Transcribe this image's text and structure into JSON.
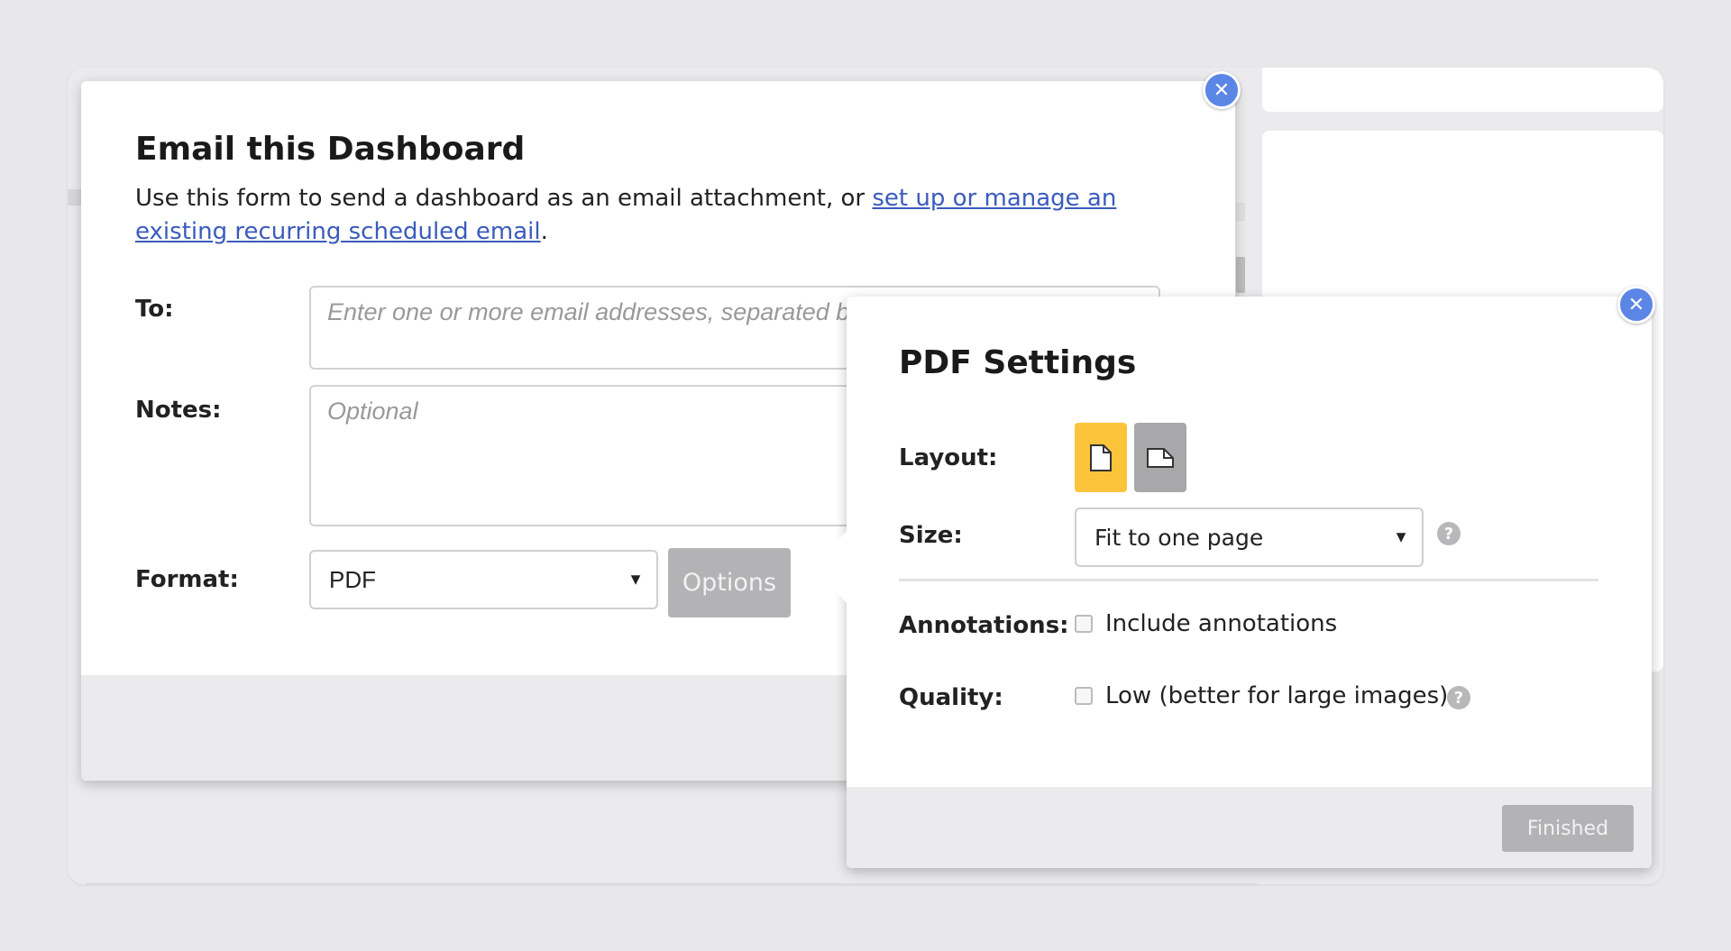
{
  "email_dialog": {
    "title": "Email this Dashboard",
    "description_prefix": "Use this form to send a dashboard as an email attachment, or ",
    "description_link": "set up or manage an existing recurring scheduled email",
    "description_suffix": ".",
    "to_label": "To:",
    "to_placeholder": "Enter one or more email addresses, separated by commas",
    "notes_label": "Notes:",
    "notes_placeholder": "Optional",
    "format_label": "Format:",
    "format_value": "PDF",
    "options_label": "Options",
    "close_icon": "close-icon"
  },
  "pdf_settings": {
    "title": "PDF Settings",
    "layout_label": "Layout:",
    "layout_selected": "portrait",
    "size_label": "Size:",
    "size_value": "Fit to one page",
    "annotations_label": "Annotations:",
    "annotations_option": "Include annotations",
    "annotations_checked": false,
    "quality_label": "Quality:",
    "quality_option": "Low (better for large images)",
    "quality_checked": false,
    "finished_label": "Finished",
    "close_icon": "close-icon"
  },
  "colors": {
    "accent_blue": "#5b86e5",
    "layout_selected": "#fcc43a",
    "button_disabled": "#b3b3b5",
    "link": "#3a5bbd"
  }
}
